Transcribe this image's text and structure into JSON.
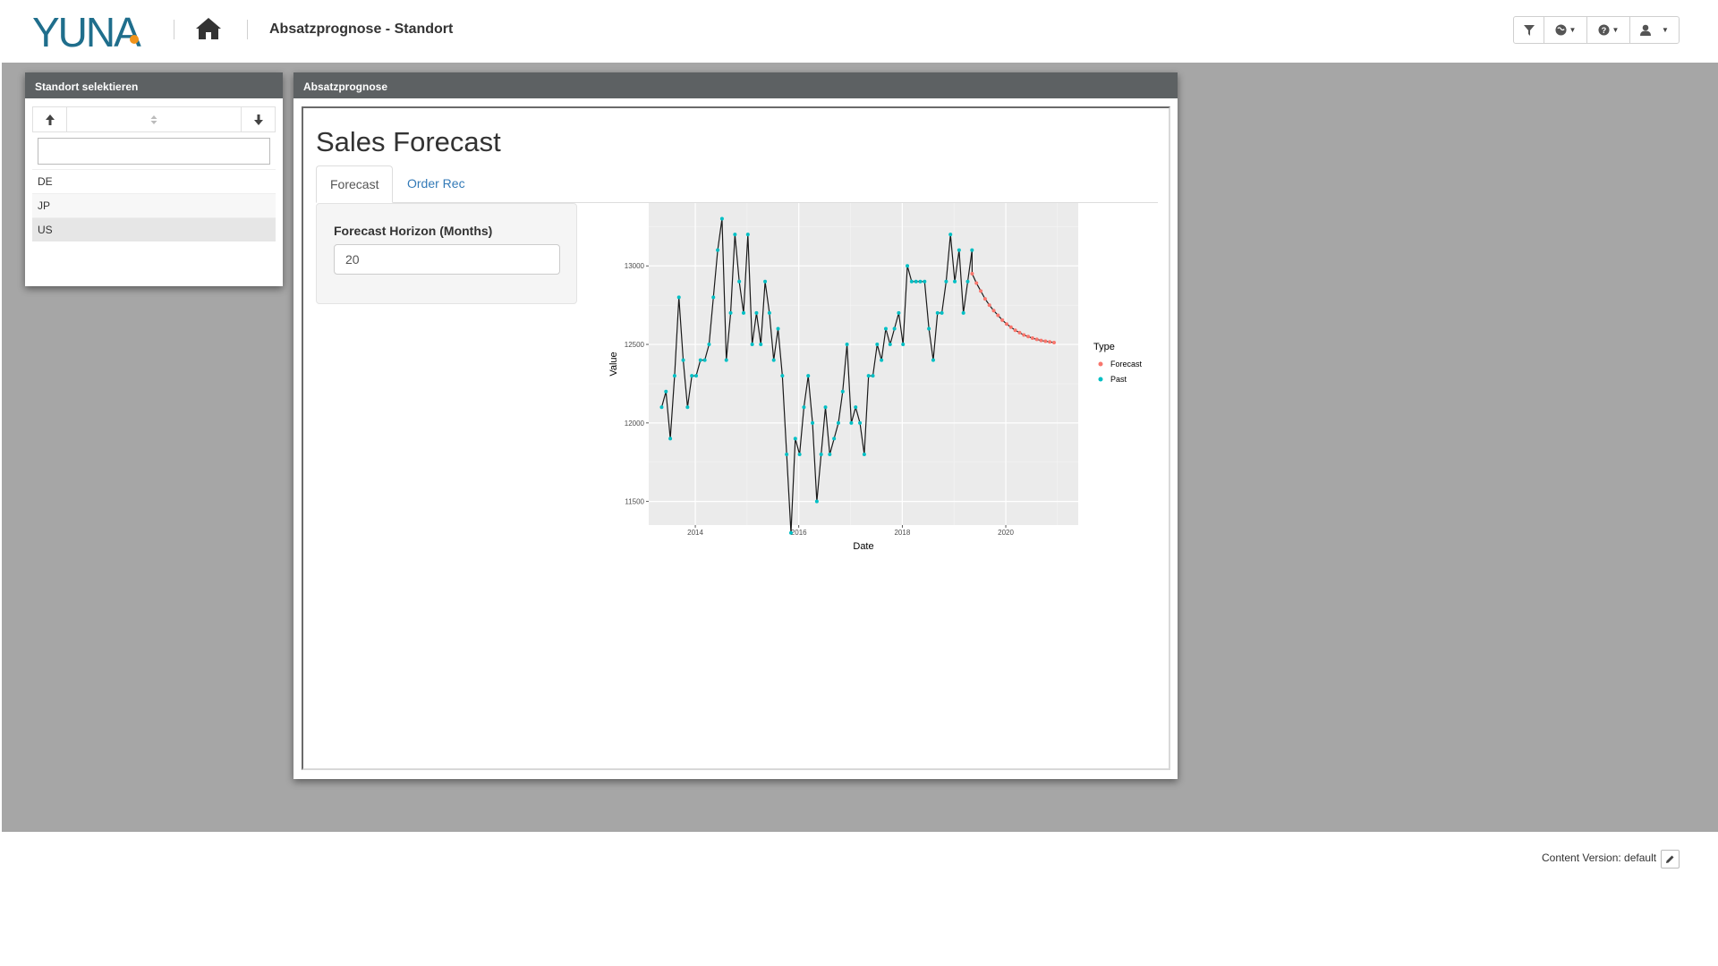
{
  "header": {
    "logo_text": "YUNA",
    "page_title": "Absatzprognose - Standort",
    "icons": [
      "home-icon",
      "filter-icon",
      "globe-icon",
      "question-icon",
      "user-icon"
    ]
  },
  "left_panel": {
    "title": "Standort selektieren",
    "search_value": "",
    "items": [
      "DE",
      "JP",
      "US"
    ],
    "selected": "US"
  },
  "main_panel": {
    "title": "Absatzprognose",
    "heading": "Sales Forecast",
    "tabs": [
      {
        "label": "Forecast",
        "active": true
      },
      {
        "label": "Order Rec",
        "active": false
      }
    ],
    "horizon_label": "Forecast Horizon (Months)",
    "horizon_value": "20"
  },
  "chart_data": {
    "type": "line",
    "xlabel": "Date",
    "ylabel": "Value",
    "x_ticks": [
      "2014",
      "2016",
      "2018",
      "2020"
    ],
    "y_ticks": [
      11500,
      12000,
      12500,
      13000
    ],
    "xlim": [
      2013.1,
      2021.4
    ],
    "ylim": [
      11350,
      13400
    ],
    "legend_title": "Type",
    "legend_position": "right",
    "grid": true,
    "series": [
      {
        "name": "Past",
        "color": "#00bfc4",
        "line_color": "#1a1a1a",
        "x_start": 2013.35,
        "x_step": 0.0833,
        "values": [
          12100,
          12200,
          11900,
          12300,
          12800,
          12400,
          12100,
          12300,
          12300,
          12400,
          12400,
          12500,
          12800,
          13100,
          13300,
          12400,
          12700,
          13200,
          12900,
          12700,
          13200,
          12500,
          12700,
          12500,
          12900,
          12700,
          12400,
          12600,
          12300,
          11800,
          11300,
          11900,
          11800,
          12100,
          12300,
          12000,
          11500,
          11800,
          12100,
          11800,
          11900,
          12000,
          12200,
          12500,
          12000,
          12100,
          12000,
          11800,
          12300,
          12300,
          12500,
          12400,
          12600,
          12500,
          12600,
          12700,
          12500,
          13000,
          12900,
          12900,
          12900,
          12900,
          12600,
          12400,
          12700,
          12700,
          12900,
          13200,
          12900,
          13100,
          12700,
          12900,
          13100
        ]
      },
      {
        "name": "Forecast",
        "color": "#f8766d",
        "x_start": 2019.35,
        "x_step": 0.0833,
        "values": [
          12950,
          12890,
          12840,
          12790,
          12750,
          12715,
          12685,
          12655,
          12630,
          12610,
          12590,
          12575,
          12560,
          12550,
          12540,
          12532,
          12525,
          12520,
          12516,
          12512
        ]
      }
    ]
  },
  "footer": {
    "content_version": "Content Version: default"
  }
}
